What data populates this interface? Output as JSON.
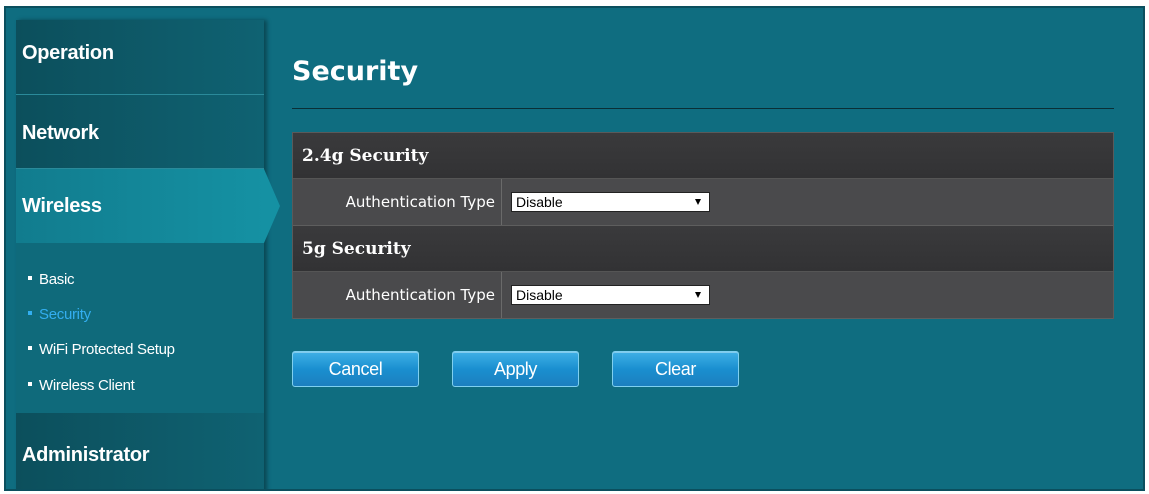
{
  "sidebar": {
    "sections": {
      "operation": "Operation",
      "network": "Network",
      "wireless": "Wireless",
      "administrator": "Administrator"
    },
    "wireless_items": [
      {
        "label": "Basic",
        "active": false
      },
      {
        "label": "Security",
        "active": true
      },
      {
        "label": "WiFi Protected Setup",
        "active": false
      },
      {
        "label": "Wireless Client",
        "active": false
      }
    ]
  },
  "main": {
    "title": "Security",
    "sections": [
      {
        "header": "2.4g Security",
        "field_label": "Authentication Type",
        "selected_value": "Disable"
      },
      {
        "header": "5g Security",
        "field_label": "Authentication Type",
        "selected_value": "Disable"
      }
    ],
    "buttons": {
      "cancel": "Cancel",
      "apply": "Apply",
      "clear": "Clear"
    }
  },
  "colors": {
    "background": "#0f6d80",
    "sidebar": "#0c5462",
    "active_item": "#33aef0",
    "table": "#3c3c3e",
    "button": "#1a8fd0"
  },
  "icons": [
    "bullet-icon",
    "dropdown-arrow-icon"
  ]
}
